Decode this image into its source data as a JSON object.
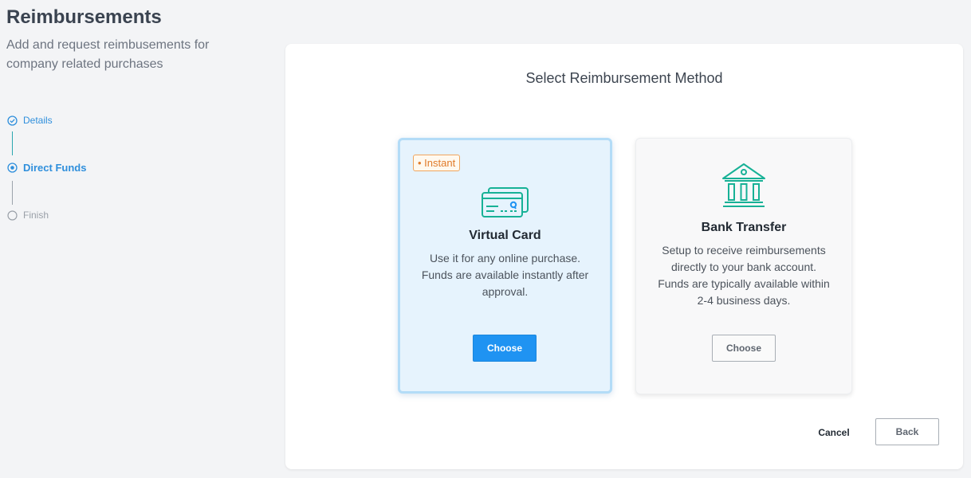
{
  "page": {
    "title": "Reimbursements",
    "subtitle": "Add and request reimbusements for company related purchases"
  },
  "steps": [
    {
      "label": "Details",
      "state": "completed"
    },
    {
      "label": "Direct Funds",
      "state": "current"
    },
    {
      "label": "Finish",
      "state": "upcoming"
    }
  ],
  "panel": {
    "title": "Select Reimbursement Method",
    "options": [
      {
        "badge": "• Instant",
        "title": "Virtual Card",
        "description": "Use it for any online purchase. Funds are available instantly after approval.",
        "button": "Choose",
        "icon": "credit-card-icon",
        "selected": true
      },
      {
        "title": "Bank Transfer",
        "description": "Setup to receive reimbursements directly to your bank account. Funds are typically available within 2-4 business days.",
        "button": "Choose",
        "icon": "bank-icon",
        "selected": false
      }
    ],
    "cancel_label": "Cancel",
    "back_label": "Back"
  },
  "colors": {
    "accent": "#1f93f2",
    "teal_icon": "#17b196",
    "badge_orange": "#e07b2a",
    "selected_card_bg": "#e6f3fd"
  }
}
